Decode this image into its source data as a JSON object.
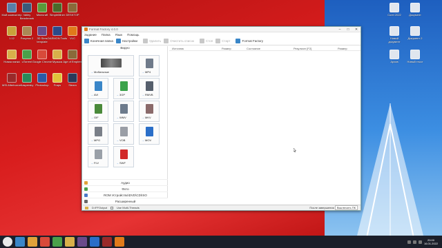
{
  "window": {
    "title": "Format Factory 4.0.0",
    "menu": [
      "Задание",
      "Папка",
      "Язык",
      "Помощь"
    ],
    "toolbar": [
      {
        "label": "Конечная папка",
        "icon": "folder-icon",
        "enabled": true
      },
      {
        "label": "Настройки",
        "icon": "settings-icon",
        "enabled": true
      },
      {
        "label": "Удалить",
        "icon": "delete-icon",
        "enabled": false
      },
      {
        "label": "Очистить список",
        "icon": "clear-list-icon",
        "enabled": false
      },
      {
        "label": "Стоп",
        "icon": "stop-icon",
        "enabled": false
      },
      {
        "label": "Старт",
        "icon": "start-icon",
        "enabled": false
      },
      {
        "label": "Format Factory",
        "icon": "logo-icon",
        "enabled": true
      }
    ]
  },
  "left_panel": {
    "category_video": "Видео",
    "formats": [
      {
        "name": "Мобильные",
        "color": "#5c6f88",
        "big": true
      },
      {
        "name": "MP4",
        "color": "#6f7a8a"
      },
      {
        "name": "AVI",
        "color": "#3a86c8"
      },
      {
        "name": "3GP",
        "color": "#3aa24a"
      },
      {
        "name": "RMVB",
        "color": "#555e6b"
      },
      {
        "name": "GIF",
        "color": "#4a8a3a"
      },
      {
        "name": "WMV",
        "color": "#6d7b8c"
      },
      {
        "name": "MKV",
        "color": "#8a6a6a"
      },
      {
        "name": "MPG",
        "color": "#7a7f88"
      },
      {
        "name": "VOB",
        "color": "#9a9ea6"
      },
      {
        "name": "MOV",
        "color": "#2a6ec8"
      },
      {
        "name": "FLV",
        "color": "#9aa0a8"
      },
      {
        "name": "SWF",
        "color": "#d22a2a"
      }
    ],
    "categories": [
      {
        "label": "Аудио",
        "color": "#e0a23a"
      },
      {
        "label": "Фото",
        "color": "#4aa04a"
      },
      {
        "label": "ROM Устройство\\DVD\\CD\\ISO",
        "color": "#4a7ac8"
      },
      {
        "label": "Расширенный",
        "color": "#6a6a6a"
      }
    ]
  },
  "task_list": {
    "columns": [
      "Источник",
      "Размер",
      "Состояние",
      "Результат [F2]",
      "Размер"
    ]
  },
  "status_bar": {
    "output_path": "D:\\FFOutput",
    "threads": "Use Multi-Threads",
    "after_converting": "После завершения",
    "elapsed": "Выключить ПК"
  },
  "desktop_icons_left": [
    {
      "label": "Мой компьютер",
      "color": "#5a7ea8"
    },
    {
      "label": "Valley Benchmark",
      "color": "#3a5a7a"
    },
    {
      "label": "Minecraft",
      "color": "#5a9a3a"
    },
    {
      "label": "SimpleMiner",
      "color": "#4a6a2a"
    },
    {
      "label": "DESKTOP",
      "color": "#8a6a3a"
    },
    {
      "label": "1.12",
      "color": "#c8a23a"
    },
    {
      "label": "Рисунок 2",
      "color": "#aa8855"
    },
    {
      "label": "3D Sims template",
      "color": "#6a4a8a"
    },
    {
      "label": "DAEMON Tools",
      "color": "#2a4a8a"
    },
    {
      "label": "VLC",
      "color": "#e07a1a"
    },
    {
      "label": "Новая папка",
      "color": "#d8b04a"
    },
    {
      "label": "uTorrent",
      "color": "#4aa04a"
    },
    {
      "label": "Google Chrome",
      "color": "#d84a3a"
    },
    {
      "label": "Музыка",
      "color": "#d8b04a"
    },
    {
      "label": "Age of Empires",
      "color": "#8a6a3a"
    },
    {
      "label": "MSI Afterburner",
      "color": "#9a2a2a"
    },
    {
      "label": "Kaspersky",
      "color": "#2a8a5a"
    },
    {
      "label": "Photoshop",
      "color": "#2a5aa8"
    },
    {
      "label": "Fraps",
      "color": "#e0c23a"
    },
    {
      "label": "Steam",
      "color": "#2a3a5a"
    }
  ],
  "desktop_icons_right": [
    {
      "label": "Corel 2022",
      "color": "#e0e6ee"
    },
    {
      "label": "Документ",
      "color": "#e0e6ee"
    },
    {
      "label": "Новый документ",
      "color": "#e0e6ee"
    },
    {
      "label": "Документ 2",
      "color": "#e0e6ee"
    },
    {
      "label": "Архив",
      "color": "#e0e6ee"
    },
    {
      "label": "Новый текст",
      "color": "#e0e6ee"
    }
  ],
  "taskbar": {
    "apps": [
      "#3a86c8",
      "#e0a23a",
      "#d84a3a",
      "#4aa04a",
      "#d8b04a",
      "#6a4a8a",
      "#2a6ec8",
      "#9a2a2a",
      "#e07a1a"
    ],
    "time": "20:00",
    "date": "16.01.2022"
  }
}
